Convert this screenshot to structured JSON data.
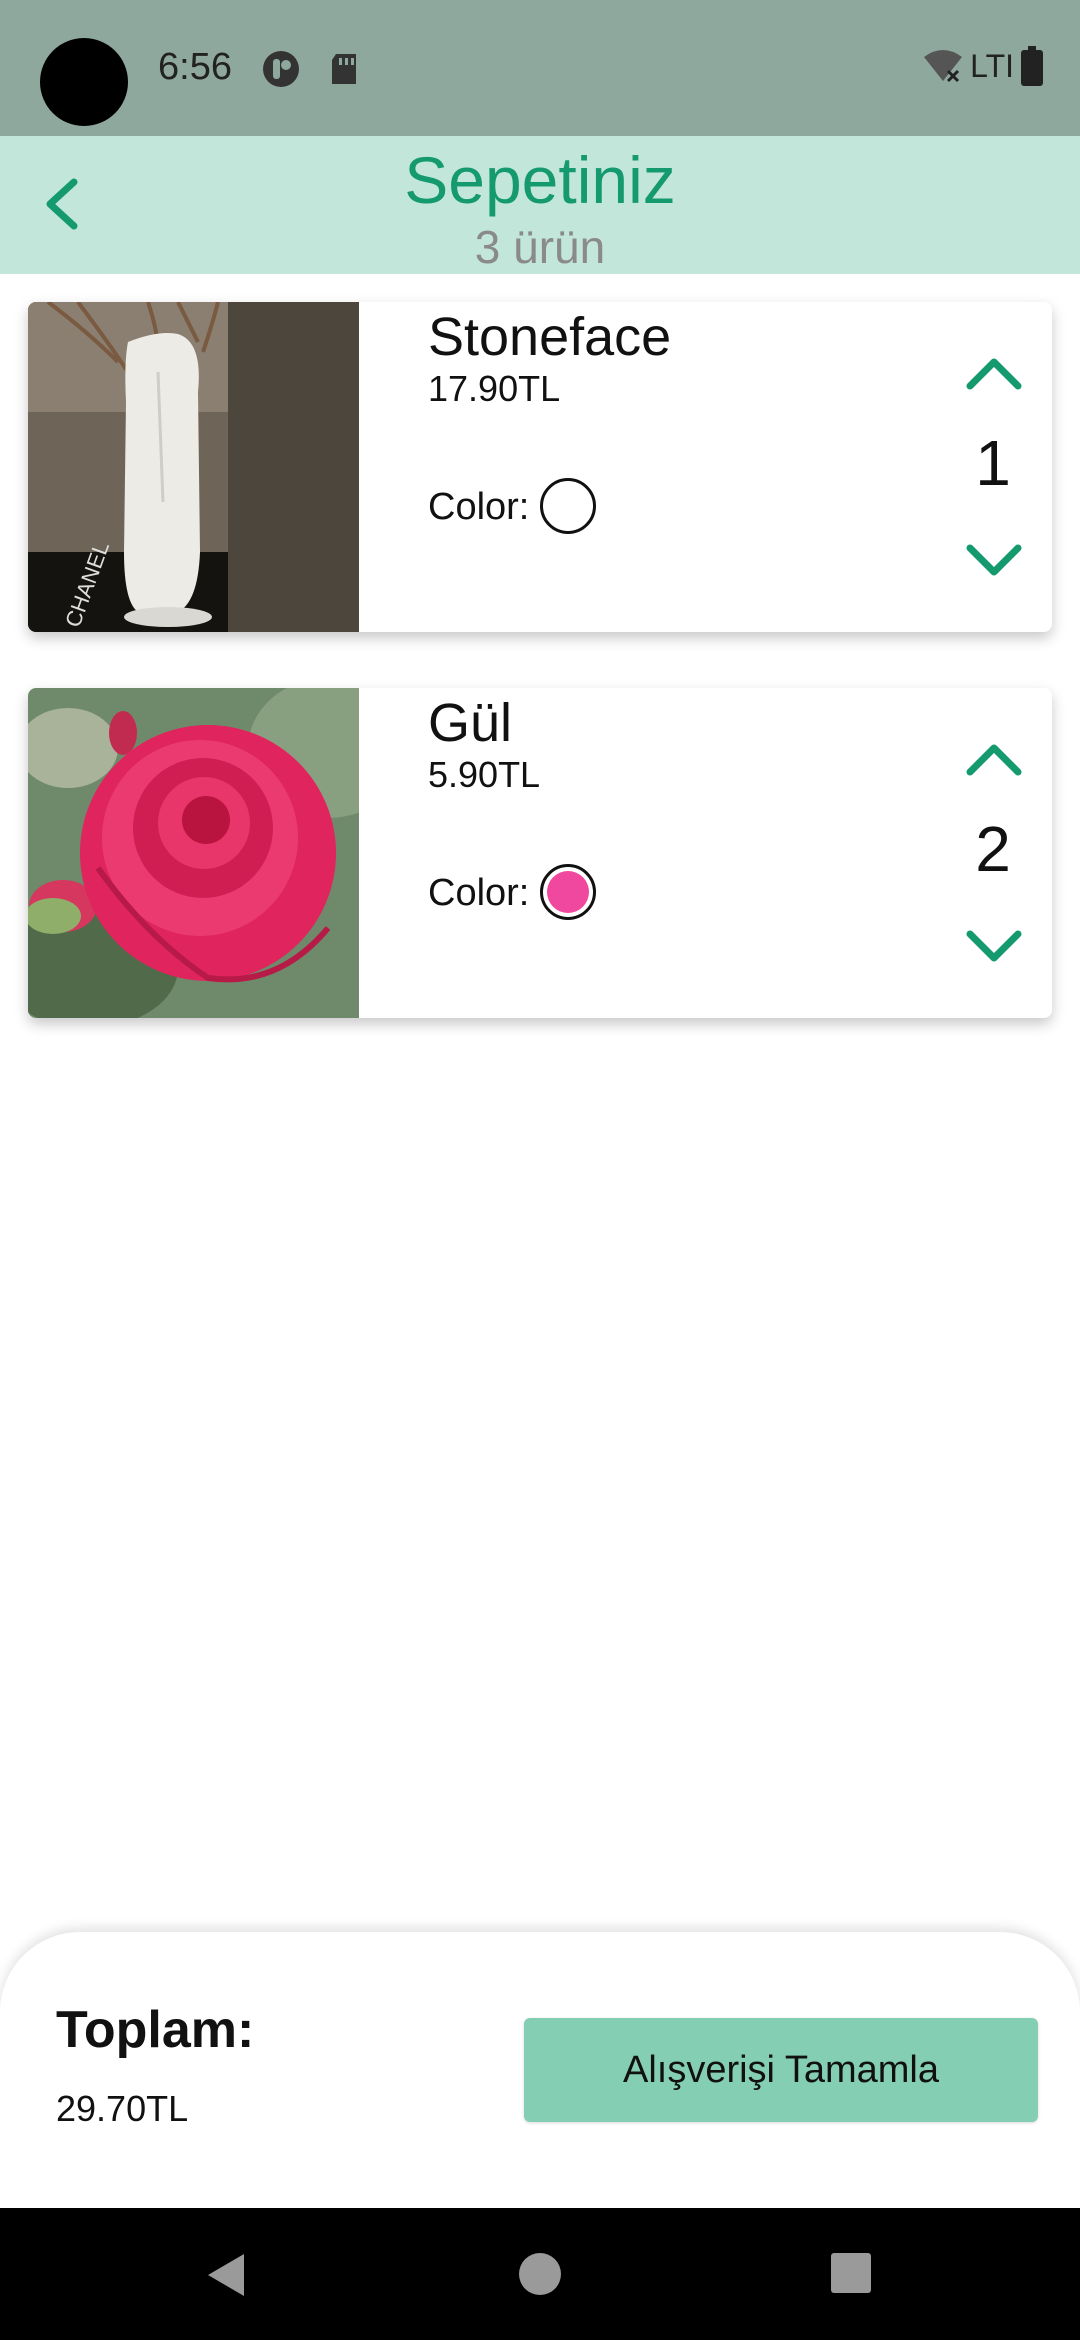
{
  "status_bar": {
    "time": "6:56",
    "network": "LTI",
    "icons": [
      "app-notification-icon",
      "sd-card-icon",
      "wifi-off-icon",
      "battery-icon"
    ]
  },
  "header": {
    "title": "Sepetiniz",
    "subtitle": "3 ürün",
    "back_icon": "chevron-left-icon"
  },
  "cart": {
    "items": [
      {
        "name": "Stoneface",
        "price": "17.90TL",
        "color_label": "Color:",
        "color_value": "#ffffff",
        "quantity": "1",
        "image": "white-face-vase-photo"
      },
      {
        "name": "Gül",
        "price": "5.90TL",
        "color_label": "Color:",
        "color_value": "#f0489f",
        "quantity": "2",
        "image": "red-rose-photo"
      }
    ]
  },
  "footer": {
    "total_label": "Toplam:",
    "total_value": "29.70TL",
    "checkout_label": "Alışverişi Tamamla"
  },
  "colors": {
    "status_bar": "#8fa89e",
    "app_bar": "#c3e6da",
    "accent": "#149a6e",
    "button": "#84ceb3"
  }
}
